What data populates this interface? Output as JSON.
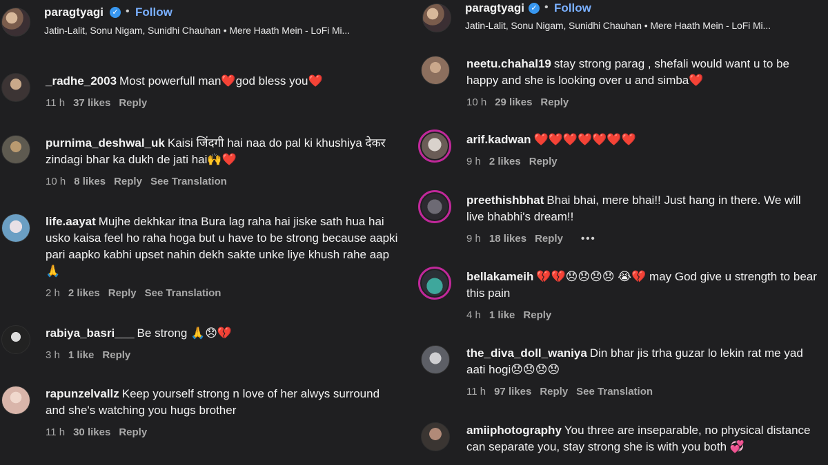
{
  "header": {
    "username": "paragtyagi",
    "dot": "•",
    "follow_label": "Follow",
    "audio": "Jatin-Lalit, Sonu Nigam, Sunidhi Chauhan • Mere Haath Mein - LoFi Mi..."
  },
  "left_comments": [
    {
      "user": "_radhe_2003",
      "text": "Most powerfull man❤️god bless you❤️",
      "time": "11 h",
      "likes": "37 likes",
      "reply": "Reply"
    },
    {
      "user": "purnima_deshwal_uk",
      "text": "Kaisi जिंदगी hai naa do pal ki khushiya देकर zindagi bhar ka dukh de jati hai🙌❤️",
      "time": "10 h",
      "likes": "8 likes",
      "reply": "Reply",
      "translate": "See Translation"
    },
    {
      "user": "life.aayat",
      "text": "Mujhe dekhkar itna Bura lag raha hai jiske sath hua hai usko kaisa feel ho raha hoga but u have to be strong because aapki pari aapko kabhi upset nahin dekh sakte unke liye khush rahe aap🙏",
      "time": "2 h",
      "likes": "2 likes",
      "reply": "Reply",
      "translate": "See Translation"
    },
    {
      "user": "rabiya_basri___",
      "text": "Be strong 🙏😞💔",
      "time": "3 h",
      "likes": "1 like",
      "reply": "Reply"
    },
    {
      "user": "rapunzelvallz",
      "text": "Keep yourself strong n love of her alwys surround and she's watching you hugs brother",
      "time": "11 h",
      "likes": "30 likes",
      "reply": "Reply"
    }
  ],
  "right_comments": [
    {
      "user": "neetu.chahal19",
      "text": "stay strong parag , shefali would want u to be happy and she is looking over u and simba❤️",
      "time": "10 h",
      "likes": "29 likes",
      "reply": "Reply"
    },
    {
      "user": "arif.kadwan",
      "text": "❤️❤️❤️❤️❤️❤️❤️",
      "time": "9 h",
      "likes": "2 likes",
      "reply": "Reply"
    },
    {
      "user": "preethishbhat",
      "text": "Bhai bhai, mere bhai!! Just hang in there. We will live bhabhi's dream!!",
      "time": "9 h",
      "likes": "18 likes",
      "reply": "Reply",
      "more": "•••"
    },
    {
      "user": "bellakameih",
      "text": "💔💔😞😞😞😞 😭💔 may God give u strength to bear this pain",
      "time": "4 h",
      "likes": "1 like",
      "reply": "Reply"
    },
    {
      "user": "the_diva_doll_waniya",
      "text": "Din bhar jis trha guzar lo lekin rat me yad aati hogi😞😞😞😞",
      "time": "11 h",
      "likes": "97 likes",
      "reply": "Reply",
      "translate": "See Translation"
    },
    {
      "user": "amiiphotography",
      "text": "You three are inseparable, no physical distance can separate you, stay strong she is with you both 💞",
      "time": "",
      "likes": "",
      "reply": ""
    }
  ]
}
